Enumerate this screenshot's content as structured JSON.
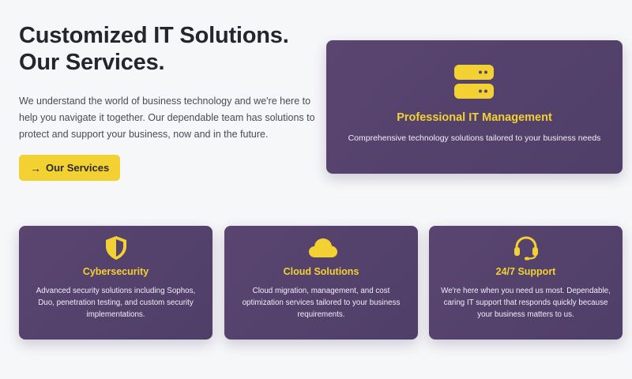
{
  "hero": {
    "title_line1": "Customized IT Solutions.",
    "title_line2": "Our Services.",
    "description": "We understand the world of business technology and we're here to help you navigate it together. Our dependable team has solutions to protect and support your business, now and in the future.",
    "cta_label": "Our Services",
    "cta_icon": "arrow-right-icon"
  },
  "featured": {
    "icon": "server-icon",
    "title": "Professional IT Management",
    "description": "Comprehensive technology solutions tailored to your business needs"
  },
  "services": [
    {
      "icon": "shield-icon",
      "title": "Cybersecurity",
      "description": "Advanced security solutions including Sophos, Duo, penetration testing, and custom security implementations."
    },
    {
      "icon": "cloud-icon",
      "title": "Cloud Solutions",
      "description": "Cloud migration, management, and cost optimization services tailored to your business requirements."
    },
    {
      "icon": "headset-icon",
      "title": "24/7 Support",
      "description": "We're here when you need us most. Dependable, caring IT support that responds quickly because your business matters to us."
    }
  ],
  "colors": {
    "accent": "#f3d132",
    "card_bg": "#56436d",
    "page_bg": "#f6f7f9",
    "heading": "#25252d"
  }
}
